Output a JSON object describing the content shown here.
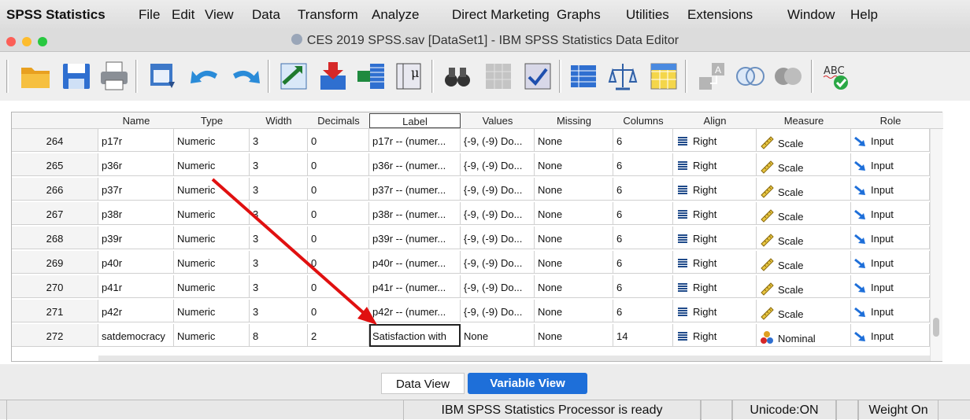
{
  "menubar": {
    "app": "SPSS Statistics",
    "items": [
      "File",
      "Edit",
      "View",
      "Data",
      "Transform",
      "Analyze",
      "Direct Marketing",
      "Graphs",
      "Utilities",
      "Extensions",
      "Window",
      "Help"
    ]
  },
  "window": {
    "title": "CES 2019 SPSS.sav [DataSet1] - IBM SPSS Statistics Data Editor"
  },
  "toolbar": {
    "icons": [
      "open-folder-icon",
      "save-icon",
      "print-icon",
      "recall-dialog-icon",
      "undo-icon",
      "redo-icon",
      "goto-case-icon",
      "goto-variable-icon",
      "variables-icon",
      "run-descriptives-icon",
      "find-icon",
      "insert-cases-icon",
      "insert-variable-icon",
      "split-file-icon",
      "weight-cases-icon",
      "select-cases-icon",
      "value-labels-icon",
      "use-sets-icon",
      "show-all-variables-icon",
      "spell-check-icon"
    ],
    "spell_label": "ABC"
  },
  "columns": [
    "Name",
    "Type",
    "Width",
    "Decimals",
    "Label",
    "Values",
    "Missing",
    "Columns",
    "Align",
    "Measure",
    "Role"
  ],
  "rows": [
    {
      "num": "264",
      "name": "p17r",
      "type": "Numeric",
      "width": "3",
      "decimals": "0",
      "label": "p17r -- (numer...",
      "values": "{-9, (-9) Do...",
      "missing": "None",
      "columns": "6",
      "align": "Right",
      "measure": "Scale",
      "role": "Input"
    },
    {
      "num": "265",
      "name": "p36r",
      "type": "Numeric",
      "width": "3",
      "decimals": "0",
      "label": "p36r -- (numer...",
      "values": "{-9, (-9) Do...",
      "missing": "None",
      "columns": "6",
      "align": "Right",
      "measure": "Scale",
      "role": "Input"
    },
    {
      "num": "266",
      "name": "p37r",
      "type": "Numeric",
      "width": "3",
      "decimals": "0",
      "label": "p37r -- (numer...",
      "values": "{-9, (-9) Do...",
      "missing": "None",
      "columns": "6",
      "align": "Right",
      "measure": "Scale",
      "role": "Input"
    },
    {
      "num": "267",
      "name": "p38r",
      "type": "Numeric",
      "width": "3",
      "decimals": "0",
      "label": "p38r -- (numer...",
      "values": "{-9, (-9) Do...",
      "missing": "None",
      "columns": "6",
      "align": "Right",
      "measure": "Scale",
      "role": "Input"
    },
    {
      "num": "268",
      "name": "p39r",
      "type": "Numeric",
      "width": "3",
      "decimals": "0",
      "label": "p39r -- (numer...",
      "values": "{-9, (-9) Do...",
      "missing": "None",
      "columns": "6",
      "align": "Right",
      "measure": "Scale",
      "role": "Input"
    },
    {
      "num": "269",
      "name": "p40r",
      "type": "Numeric",
      "width": "3",
      "decimals": "0",
      "label": "p40r -- (numer...",
      "values": "{-9, (-9) Do...",
      "missing": "None",
      "columns": "6",
      "align": "Right",
      "measure": "Scale",
      "role": "Input"
    },
    {
      "num": "270",
      "name": "p41r",
      "type": "Numeric",
      "width": "3",
      "decimals": "0",
      "label": "p41r -- (numer...",
      "values": "{-9, (-9) Do...",
      "missing": "None",
      "columns": "6",
      "align": "Right",
      "measure": "Scale",
      "role": "Input"
    },
    {
      "num": "271",
      "name": "p42r",
      "type": "Numeric",
      "width": "3",
      "decimals": "0",
      "label": "p42r -- (numer...",
      "values": "{-9, (-9) Do...",
      "missing": "None",
      "columns": "6",
      "align": "Right",
      "measure": "Scale",
      "role": "Input"
    },
    {
      "num": "272",
      "name": "satdemocracy",
      "type": "Numeric",
      "width": "8",
      "decimals": "2",
      "label": "Satisfaction with",
      "values": "None",
      "missing": "None",
      "columns": "14",
      "align": "Right",
      "measure": "Nominal",
      "role": "Input"
    }
  ],
  "tabs": {
    "data_view": "Data View",
    "variable_view": "Variable View"
  },
  "status": {
    "processor": "IBM SPSS Statistics Processor is ready",
    "unicode": "Unicode:ON",
    "weight": "Weight On"
  },
  "colors": {
    "accent": "#1e6fd9",
    "arrow": "#e01010"
  }
}
